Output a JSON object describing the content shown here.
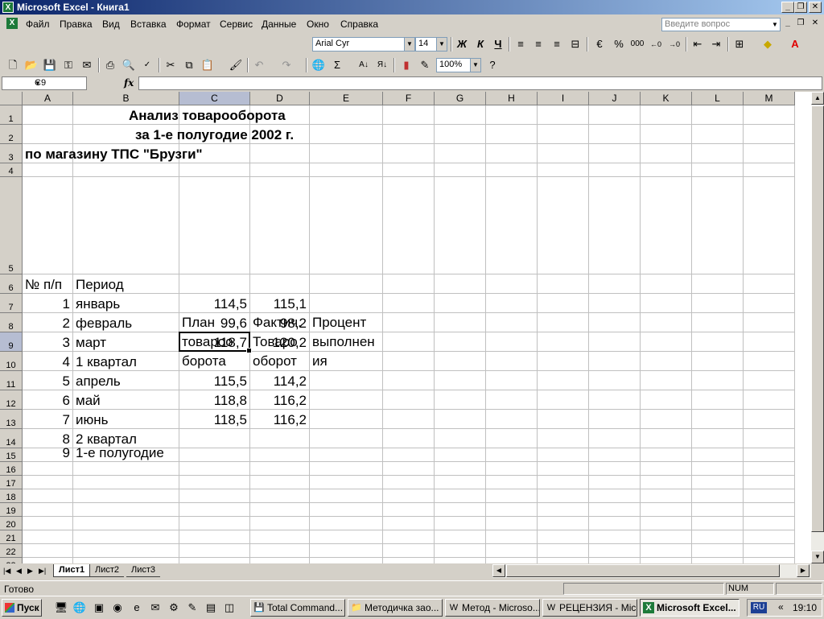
{
  "window": {
    "title": "Microsoft Excel - Книга1"
  },
  "menu": [
    "Файл",
    "Правка",
    "Вид",
    "Вставка",
    "Формат",
    "Сервис",
    "Данные",
    "Окно",
    "Справка"
  ],
  "help_placeholder": "Введите вопрос",
  "format_toolbar": {
    "font": "Arial Cyr",
    "size": "14",
    "bold": "Ж",
    "italic": "К",
    "underline": "Ч",
    "percent": "%",
    "thousands": "000"
  },
  "standard_toolbar": {
    "zoom": "100%"
  },
  "formula_bar": {
    "name_box": "C9",
    "fx": "fx",
    "formula": ""
  },
  "columns": [
    "A",
    "B",
    "C",
    "D",
    "E",
    "F",
    "G",
    "H",
    "I",
    "J",
    "K",
    "L",
    "M"
  ],
  "rows": [
    "1",
    "2",
    "3",
    "4",
    "5",
    "6",
    "7",
    "8",
    "9",
    "10",
    "11",
    "12",
    "13",
    "14",
    "15",
    "16",
    "17",
    "18",
    "19",
    "20",
    "21",
    "22",
    "23"
  ],
  "selected_cell": "C9",
  "sheet": {
    "title1": "Анализ товарооборота",
    "title2": "за 1-е полугодие 2002 г.",
    "title3": "по магазину ТПС \"Брузги\"",
    "header": {
      "num": "№ п/п",
      "period": "Период",
      "plan": [
        "План",
        "товароо",
        "борота"
      ],
      "fact": [
        "Фактич.",
        "Товаро",
        "оборот"
      ],
      "percent": [
        "Процент",
        "выполнен",
        "ия"
      ]
    },
    "data": [
      {
        "num": "1",
        "period": "январь",
        "plan": "114,5",
        "fact": "115,1"
      },
      {
        "num": "2",
        "period": "февраль",
        "plan": "99,6",
        "fact": "98,2"
      },
      {
        "num": "3",
        "period": "март",
        "plan": "118,7",
        "fact": "120,2"
      },
      {
        "num": "4",
        "period": "1 квартал",
        "plan": "",
        "fact": ""
      },
      {
        "num": "5",
        "period": "апрель",
        "plan": "115,5",
        "fact": "114,2"
      },
      {
        "num": "6",
        "period": "май",
        "plan": "118,8",
        "fact": "116,2"
      },
      {
        "num": "7",
        "period": "июнь",
        "plan": "118,5",
        "fact": "116,2"
      },
      {
        "num": "8",
        "period": "2 квартал",
        "plan": "",
        "fact": ""
      },
      {
        "num": "9",
        "period": "1-е полугодие",
        "plan": "",
        "fact": ""
      }
    ]
  },
  "sheet_tabs": [
    "Лист1",
    "Лист2",
    "Лист3"
  ],
  "status": {
    "text": "Готово",
    "num": "NUM"
  },
  "taskbar": {
    "start": "Пуск",
    "tasks": [
      "Total Command...",
      "Методичка зао...",
      "Метод - Microso...",
      "РЕЦЕНЗИЯ - Mic...",
      "Microsoft Excel..."
    ],
    "lang": "RU",
    "time": "19:10"
  }
}
